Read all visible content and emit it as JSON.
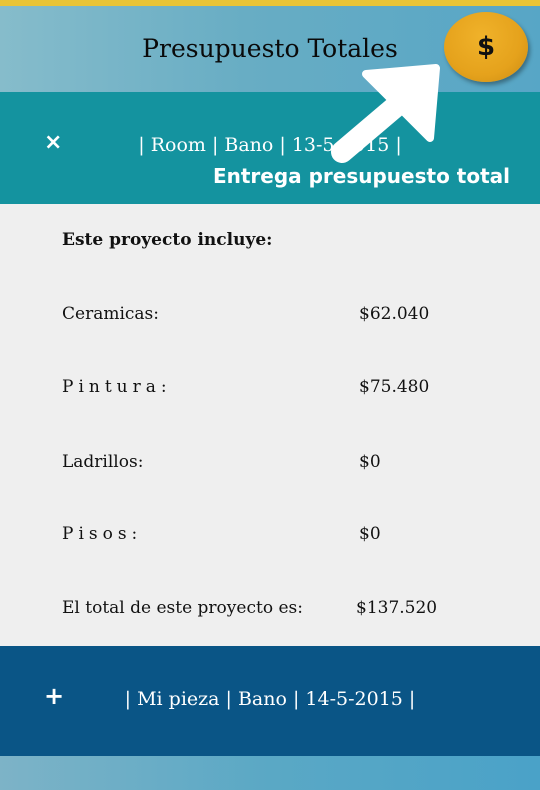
{
  "header": {
    "title": "Presupuesto Totales",
    "coin_symbol": "$"
  },
  "panels": [
    {
      "toggle_icon": "×",
      "title": "| Room | Bano | 13-5-2015 |",
      "subtitle": "Entrega presupuesto total",
      "intro": "Este proyecto incluye:",
      "items": [
        {
          "label": "Ceramicas:",
          "value": "$62.040"
        },
        {
          "label": "Pintura:",
          "value": "$75.480"
        },
        {
          "label": "Ladrillos:",
          "value": "$0"
        },
        {
          "label": "Pisos:",
          "value": "$0"
        }
      ],
      "total_label": "El total de este proyecto es:",
      "total_value": "$137.520"
    },
    {
      "toggle_icon": "+",
      "title": "| Mi pieza | Bano | 14-5-2015 |"
    }
  ],
  "colors": {
    "panel_expanded": "#14939f",
    "panel_collapsed": "#0a5586",
    "coin": "#e5a21c",
    "content_bg": "#efefef"
  }
}
